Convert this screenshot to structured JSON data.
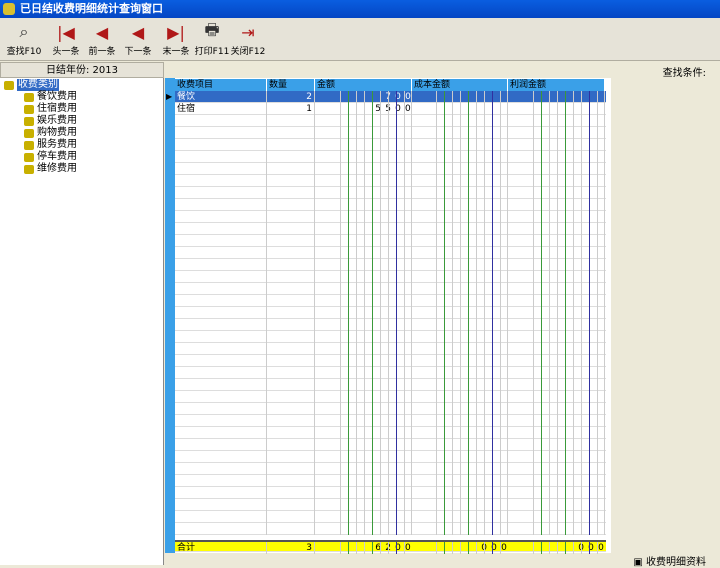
{
  "window": {
    "title": "已日结收费明细统计查询窗口"
  },
  "toolbar": [
    {
      "label": "查找F10",
      "icon": "search-icon"
    },
    {
      "label": "头一条",
      "icon": "first-icon"
    },
    {
      "label": "前一条",
      "icon": "prev-icon"
    },
    {
      "label": "下一条",
      "icon": "next-icon"
    },
    {
      "label": "末一条",
      "icon": "last-icon"
    },
    {
      "label": "打印F11",
      "icon": "printer-icon"
    },
    {
      "label": "关闭F12",
      "icon": "exit-icon"
    }
  ],
  "left": {
    "header": "日结年份: 2013",
    "root": "收费类别",
    "items": [
      "餐饮费用",
      "住宿费用",
      "娱乐费用",
      "购物费用",
      "服务费用",
      "停车费用",
      "维修费用"
    ]
  },
  "right": {
    "search_label": "查找条件:"
  },
  "table": {
    "columns": [
      "收费项目",
      "数量",
      "金额",
      "成本金额",
      "利润金额"
    ],
    "rows": [
      {
        "item": "餐饮",
        "qty": "2",
        "amount": "700",
        "cost": "",
        "profit": ""
      },
      {
        "item": "住宿",
        "qty": "1",
        "amount": "5500",
        "cost": "",
        "profit": ""
      }
    ],
    "total": {
      "item": "合计",
      "qty": "3",
      "amount": "6200",
      "cost": "000",
      "profit": "000"
    }
  },
  "status": "收费明细资料",
  "colors": {
    "header": "#3aa0e8",
    "selected": "#316ac5",
    "total": "#ffff00"
  }
}
